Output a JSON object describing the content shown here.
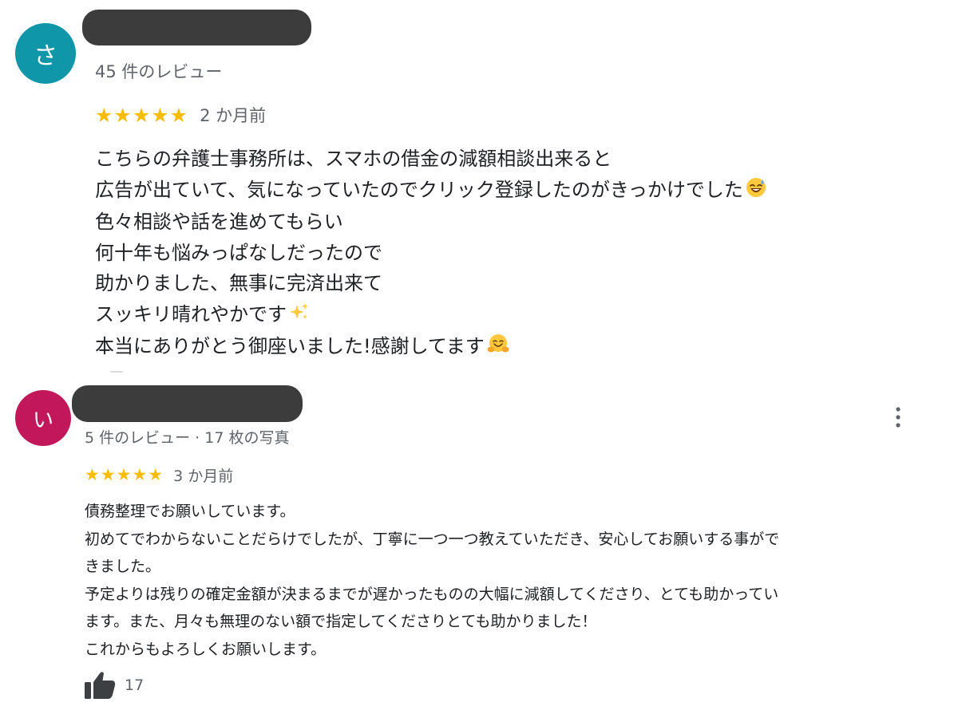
{
  "reviews": [
    {
      "avatar_letter": "さ",
      "avatar_color": "#0f96a8",
      "meta": "45 件のレビュー",
      "stars": "★★★★★",
      "rating": 5,
      "date": "2 か月前",
      "lines": [
        "こちらの弁護士事務所は、スマホの借金の減額相談出来ると",
        "広告が出ていて、気になっていたのでクリック登録したのがきっかけでした",
        "色々相談や話を進めてもらい",
        "何十年も悩みっぱなしだったので",
        "助かりました、無事に完済出来て",
        "スッキリ晴れやかです",
        "本当にありがとう御座いました!感謝してます"
      ]
    },
    {
      "avatar_letter": "い",
      "avatar_color": "#c2185b",
      "meta": "5 件のレビュー · 17 枚の写真",
      "stars": "★★★★★",
      "rating": 5,
      "date": "3 か月前",
      "lines": [
        "債務整理でお願いしています。",
        "初めてでわからないことだらけでしたが、丁寧に一つ一つ教えていただき、安心してお願いする事がで",
        "きました。",
        "予定よりは残りの確定金額が決まるまでが遅かったものの大幅に減額してくださり、とても助かってい",
        "ます。また、月々も無理のない額で指定してくださりとても助かりました！",
        "これからもよろしくお願いします。"
      ],
      "likes": "17"
    }
  ],
  "icons": {
    "menu": "more-vertical-icon",
    "like": "thumbs-up-icon",
    "emoji_1": "sweat-smile-emoji",
    "emoji_2": "sparkles-emoji",
    "emoji_3": "hugging-face-emoji"
  },
  "colors": {
    "star": "#fbbc04",
    "meta_text": "#5f6368",
    "body_text": "#202124",
    "redaction": "#3c3c3c"
  }
}
